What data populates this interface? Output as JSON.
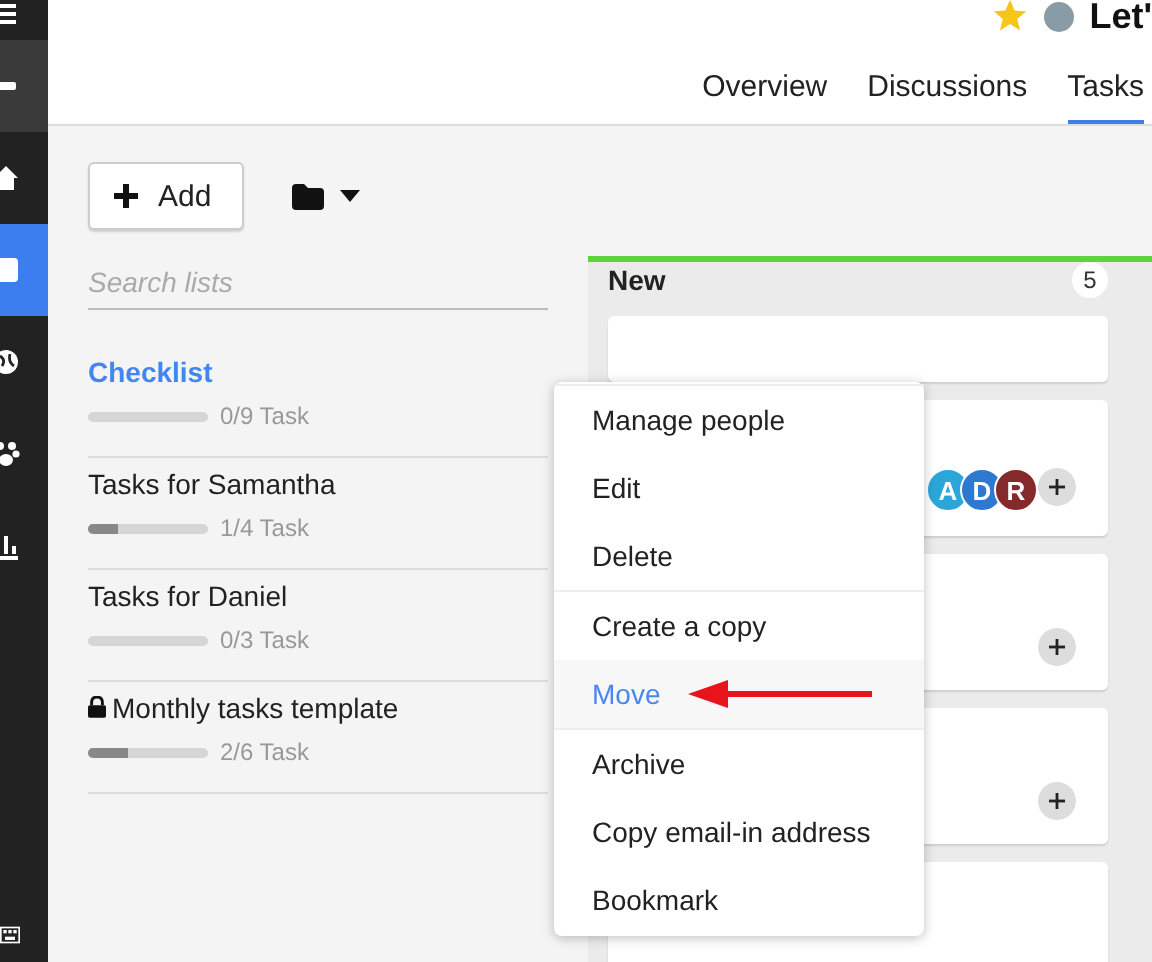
{
  "sidebar": {
    "items": [
      {
        "selected": false
      },
      {
        "selected": false
      },
      {
        "selected": false
      },
      {
        "selected": true
      },
      {
        "selected": false
      },
      {
        "selected": false
      },
      {
        "selected": false
      }
    ]
  },
  "header": {
    "title": "Let'",
    "starred": true,
    "tabs": [
      {
        "label": "Overview",
        "selected": false
      },
      {
        "label": "Discussions",
        "selected": false
      },
      {
        "label": "Tasks",
        "selected": true
      }
    ]
  },
  "toolbar": {
    "add_button": "Add"
  },
  "search": {
    "placeholder": "Search lists"
  },
  "lists": [
    {
      "name": "Checklist",
      "selected": true,
      "locked": false,
      "level": 0,
      "count": "0/9 Task"
    },
    {
      "name": "Tasks for Samantha",
      "selected": false,
      "locked": false,
      "level": 0.25,
      "count": "1/4 Task"
    },
    {
      "name": "Tasks for Daniel",
      "selected": false,
      "locked": false,
      "level": 0,
      "count": "0/3 Task"
    },
    {
      "name": "Monthly tasks template",
      "selected": false,
      "locked": true,
      "level": 0.333,
      "count": "2/6 Task"
    }
  ],
  "column": {
    "title": "New",
    "count": "5",
    "color": "#5fd43a",
    "cards": [
      {
        "kind": "blank"
      },
      {
        "kind": "assigned",
        "avatars": [
          {
            "letter": "A",
            "color": "#2aa6d8"
          },
          {
            "letter": "D",
            "color": "#2d79d2"
          },
          {
            "letter": "R",
            "color": "#86292b"
          }
        ]
      },
      {
        "kind": "unassigned"
      },
      {
        "kind": "unassigned"
      },
      {
        "kind": "blank"
      }
    ]
  },
  "menu": {
    "groups": [
      [
        {
          "label": "Manage people",
          "selected": false
        },
        {
          "label": "Edit",
          "selected": false
        },
        {
          "label": "Delete",
          "selected": false
        }
      ],
      [
        {
          "label": "Create a copy",
          "selected": false
        },
        {
          "label": "Move",
          "selected": true
        }
      ],
      [
        {
          "label": "Archive",
          "selected": false
        },
        {
          "label": "Copy email-in address",
          "selected": false
        },
        {
          "label": "Bookmark",
          "selected": false
        }
      ]
    ]
  }
}
